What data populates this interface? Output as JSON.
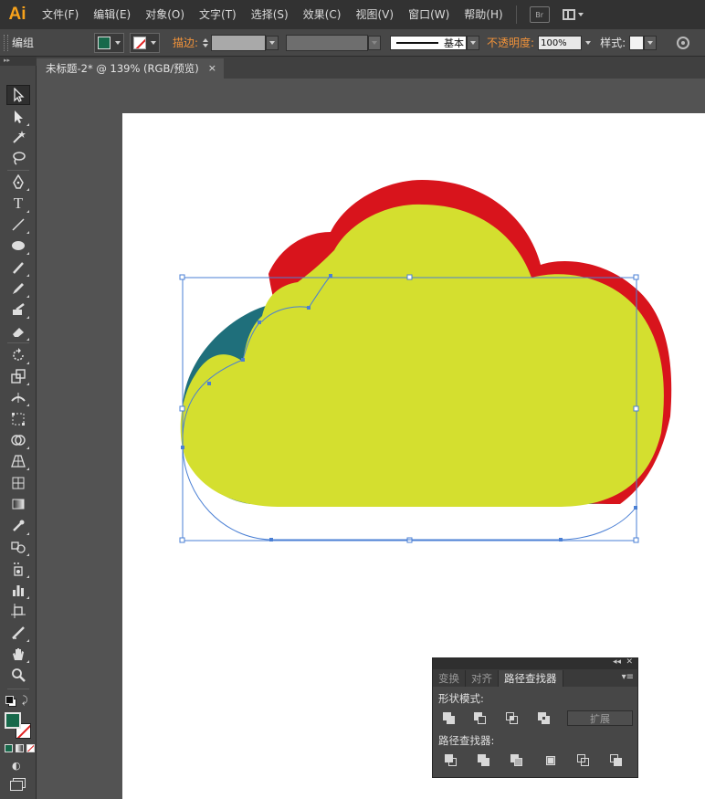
{
  "app": {
    "logo": "Ai"
  },
  "menu": [
    "文件(F)",
    "编辑(E)",
    "对象(O)",
    "文字(T)",
    "选择(S)",
    "效果(C)",
    "视图(V)",
    "窗口(W)",
    "帮助(H)"
  ],
  "menu_extras": {
    "bridge_label": "Br"
  },
  "control_bar": {
    "selection_label": "编组",
    "stroke_label": "描边:",
    "stroke_style_label": "基本",
    "opacity_label": "不透明度:",
    "opacity_value": "100%",
    "style_label": "样式:",
    "fill_color": "#17694b",
    "stroke_color": "none"
  },
  "document_tab": {
    "title": "未标题-2* @ 139% (RGB/预览)",
    "close_glyph": "×"
  },
  "tools": [
    "selection-tool",
    "direct-selection-tool",
    "magic-wand-tool",
    "lasso-tool",
    "pen-tool",
    "type-tool",
    "line-segment-tool",
    "ellipse-tool",
    "paintbrush-tool",
    "pencil-tool",
    "blob-brush-tool",
    "eraser-tool",
    "rotate-tool",
    "scale-tool",
    "width-tool",
    "free-transform-tool",
    "shape-builder-tool",
    "perspective-grid-tool",
    "mesh-tool",
    "gradient-tool",
    "eyedropper-tool",
    "blend-tool",
    "symbol-sprayer-tool",
    "column-graph-tool",
    "artboard-tool",
    "slice-tool",
    "hand-tool",
    "zoom-tool"
  ],
  "artwork": {
    "shape": "cloud",
    "fill_color": "#d4df2f",
    "shadow_color_red": "#d8141c",
    "shadow_color_teal": "#1f6f7b",
    "selection_color": "#4a7fd4"
  },
  "pathfinder_panel": {
    "tabs": [
      "变换",
      "对齐",
      "路径查找器"
    ],
    "active_tab": 2,
    "shape_modes_label": "形状模式:",
    "pathfinders_label": "路径查找器:",
    "expand_label": "扩展",
    "collapse_glyph": "◂◂",
    "close_glyph": "✕",
    "menu_glyph": "▾≡"
  }
}
